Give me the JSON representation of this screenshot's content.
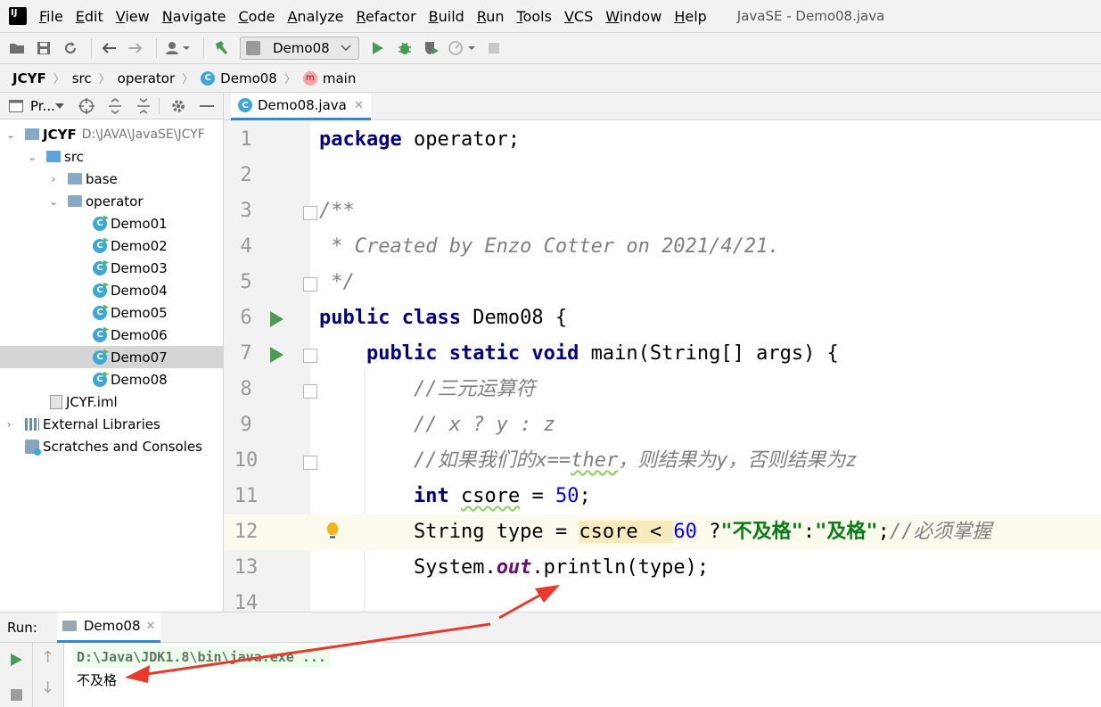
{
  "menu": {
    "items": [
      "File",
      "Edit",
      "View",
      "Navigate",
      "Code",
      "Analyze",
      "Refactor",
      "Build",
      "Run",
      "Tools",
      "VCS",
      "Window",
      "Help"
    ],
    "window_title": "JavaSE - Demo08.java"
  },
  "toolbar": {
    "run_config": "Demo08"
  },
  "breadcrumb": {
    "items": [
      "JCYF",
      "src",
      "operator",
      "Demo08",
      "main"
    ]
  },
  "project_panel": {
    "title": "Pr...",
    "tree": [
      {
        "label": "JCYF",
        "path": "D:\\JAVA\\JavaSE\\JCYF"
      },
      {
        "label": "src"
      },
      {
        "label": "base"
      },
      {
        "label": "operator"
      },
      {
        "label": "Demo01"
      },
      {
        "label": "Demo02"
      },
      {
        "label": "Demo03"
      },
      {
        "label": "Demo04"
      },
      {
        "label": "Demo05"
      },
      {
        "label": "Demo06"
      },
      {
        "label": "Demo07"
      },
      {
        "label": "Demo08"
      },
      {
        "label": "JCYF.iml"
      },
      {
        "label": "External Libraries"
      },
      {
        "label": "Scratches and Consoles"
      }
    ]
  },
  "editor": {
    "tab_label": "Demo08.java",
    "line_numbers": [
      "1",
      "2",
      "3",
      "4",
      "5",
      "6",
      "7",
      "8",
      "9",
      "10",
      "11",
      "12",
      "13",
      "14"
    ],
    "tokens": {
      "l1_kw": "package",
      "l1_rest": " operator;",
      "l3": "/**",
      "l4": " * Created by Enzo Cotter on 2021/4/21.",
      "l5": " */",
      "l6_kw": "public class",
      "l6_rest": " Demo08 {",
      "l7_indent": "    ",
      "l7_kw": "public static void",
      "l7_rest": " main(String[] args) {",
      "indent": "        ",
      "l8": "//三元运算符",
      "l9": "// x ? y : z",
      "l10_a": "//如果我们的x==",
      "l10_b": "ther",
      "l10_c": "，则结果为y，否则结果为z",
      "l11_kw": "int",
      "l11_sp": " ",
      "l11_var": "csore",
      "l11_eq": " = ",
      "l11_num": "50",
      "l11_end": ";",
      "l12_a": "String type = ",
      "l12_hl": "csore < ",
      "l12_num": "60",
      "l12_b": " ?",
      "l12_s1": "\"不及格\"",
      "l12_c": ":",
      "l12_s2": "\"及格\"",
      "l12_d": ";",
      "l12_cm": "//必须掌握",
      "l13_a": "System.",
      "l13_fld": "out",
      "l13_b": ".println(type);"
    }
  },
  "run_panel": {
    "label": "Run:",
    "tab_label": "Demo08",
    "command": "D:\\Java\\JDK1.8\\bin\\java.exe ...",
    "output": "不及格"
  },
  "colors": {
    "keyword": "#000080",
    "comment": "#808080",
    "number": "#0000ff",
    "string": "#067d17",
    "annotation_arrow": "#e8392c",
    "run_green": "#499c54"
  }
}
